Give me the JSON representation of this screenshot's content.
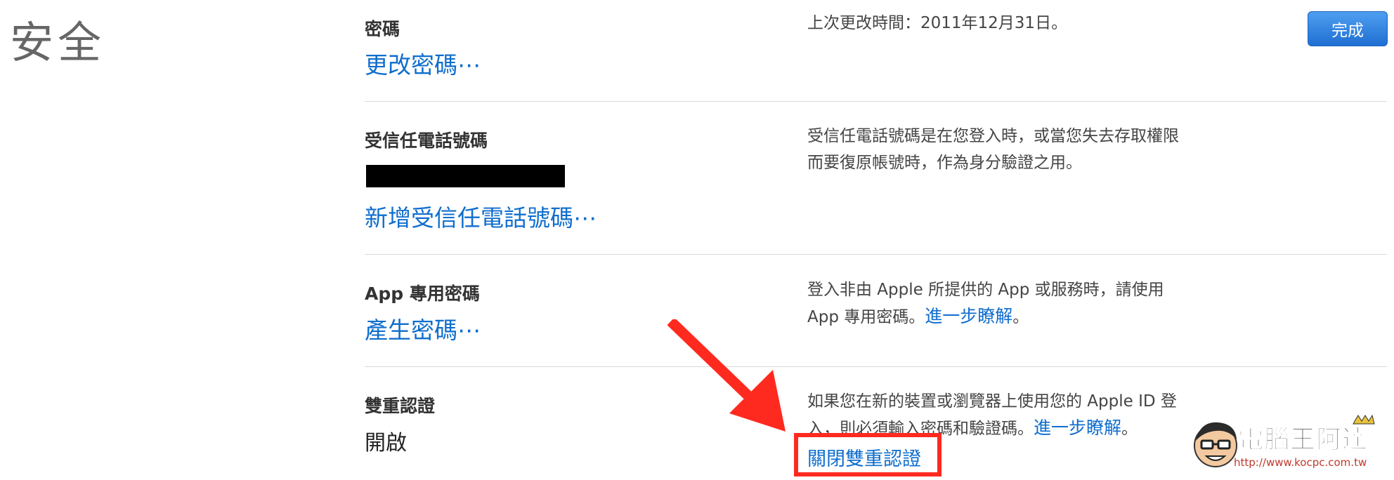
{
  "page_title": "安全",
  "done_button": "完成",
  "sections": [
    {
      "title": "密碼",
      "link": "更改密碼⋯",
      "description": "上次更改時間：2011年12月31日。"
    },
    {
      "title": "受信任電話號碼",
      "link": "新增受信任電話號碼⋯",
      "description_line1": "受信任電話號碼是在您登入時，或當您失去存取權限",
      "description_line2": "而要復原帳號時，作為身分驗證之用。"
    },
    {
      "title": "App 專用密碼",
      "link": "產生密碼⋯",
      "description_line1": "登入非由 Apple 所提供的 App 或服務時，請使用",
      "description_line2_prefix": "App 專用密碼。",
      "learn_more": "進一步瞭解",
      "description_line2_suffix": "。"
    },
    {
      "title": "雙重認證",
      "status": "開啟",
      "description_line1": "如果您在新的裝置或瀏覽器上使用您的 Apple ID 登",
      "description_line2_prefix": "入，則必須輸入密碼和驗證碼。",
      "learn_more": "進一步瞭解",
      "description_line2_suffix": "。",
      "action_link": "關閉雙重認證"
    }
  ],
  "watermark": {
    "name": "電腦王阿達",
    "url": "http://www.kocpc.com.tw"
  },
  "colors": {
    "link": "#0f6ecd",
    "button": "#1f6fd3",
    "annotation": "#ff2a1f"
  }
}
